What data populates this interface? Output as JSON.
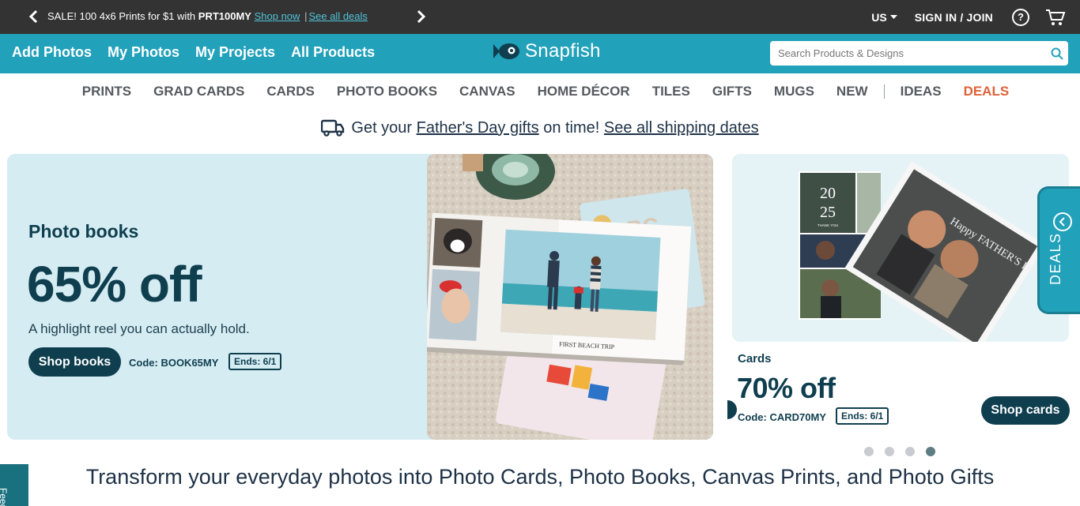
{
  "promo": {
    "text": "SALE! 100 4x6 Prints for $1 with ",
    "code": "PRT100MY",
    "shop_now": "Shop now",
    "separator": "|",
    "see_all": "See all deals"
  },
  "header": {
    "region": "US",
    "signin": "SIGN IN / JOIN",
    "help_icon_text": "?"
  },
  "nav": {
    "links": [
      "Add Photos",
      "My Photos",
      "My Projects",
      "All Products"
    ],
    "logo": "Snapfish",
    "search_placeholder": "Search Products & Designs"
  },
  "categories": [
    "PRINTS",
    "GRAD CARDS",
    "CARDS",
    "PHOTO BOOKS",
    "CANVAS",
    "HOME DÉCOR",
    "TILES",
    "GIFTS",
    "MUGS",
    "NEW",
    "IDEAS",
    "DEALS"
  ],
  "shipping": {
    "prefix": "Get your ",
    "link1": "Father's Day gifts",
    "middle": " on time! ",
    "link2": "See all shipping dates"
  },
  "hero1": {
    "title": "Photo books",
    "offer": "65% off",
    "subtitle": "A highlight reel you can actually hold.",
    "button": "Shop books",
    "code": "Code:  BOOK65MY",
    "ends": "Ends: 6/1",
    "book_caption": "FIRST BEACH TRIP"
  },
  "hero2": {
    "title": "Cards",
    "offer": "70% off",
    "code": "Code:  CARD70MY",
    "ends": "Ends:  6/1",
    "button": "Shop cards",
    "card_year_top": "20",
    "card_year_bottom": "25",
    "card_sub": "THANK YOU",
    "card_script": "Happy FATHER'S DAY"
  },
  "deals_tab": "DEALS",
  "tagline": "Transform your everyday photos into Photo Cards, Photo Books, Canvas Prints, and Photo Gifts",
  "feedback": "Feedback",
  "colors": {
    "promo_bg": "#333333",
    "nav_bg": "#22a1ba",
    "hero_bg": "#d4ecf2",
    "dark_teal": "#0f3e4f",
    "deals_orange": "#e0623a"
  },
  "carousel": {
    "count": 4,
    "active_index": 4
  }
}
